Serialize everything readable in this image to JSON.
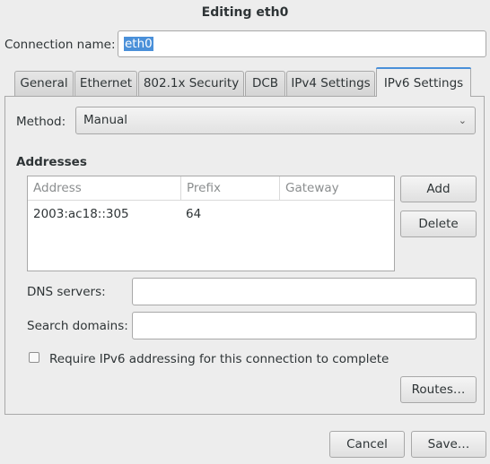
{
  "window": {
    "title": "Editing eth0"
  },
  "connection": {
    "label": "Connection name:",
    "value": "eth0"
  },
  "tabs": [
    {
      "label": "General",
      "active": false
    },
    {
      "label": "Ethernet",
      "active": false
    },
    {
      "label": "802.1x Security",
      "active": false
    },
    {
      "label": "DCB",
      "active": false
    },
    {
      "label": "IPv4 Settings",
      "active": false
    },
    {
      "label": "IPv6 Settings",
      "active": true
    }
  ],
  "method": {
    "label": "Method:",
    "value": "Manual"
  },
  "addresses": {
    "heading": "Addresses",
    "columns": [
      "Address",
      "Prefix",
      "Gateway"
    ],
    "rows": [
      {
        "address": "2003:ac18::305",
        "prefix": "64",
        "gateway": ""
      }
    ],
    "add_label": "Add",
    "delete_label": "Delete"
  },
  "dns": {
    "label": "DNS servers:",
    "value": ""
  },
  "search_domains": {
    "label": "Search domains:",
    "value": ""
  },
  "require_ipv6": {
    "label": "Require IPv6 addressing for this connection to complete",
    "checked": false
  },
  "routes_label": "Routes…",
  "footer": {
    "cancel_label": "Cancel",
    "save_label": "Save…"
  },
  "colors": {
    "accent": "#4a90d9",
    "window_bg": "#ededed"
  }
}
